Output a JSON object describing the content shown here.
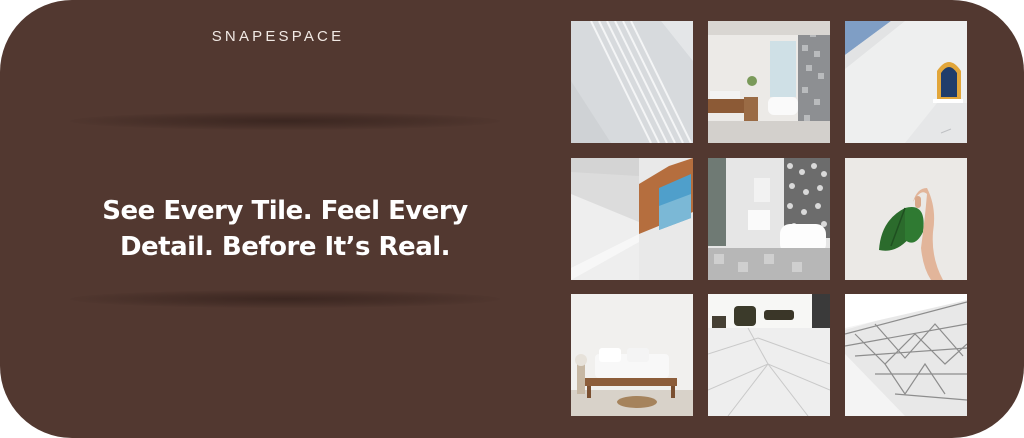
{
  "brand": {
    "name": "SNAPESPACE"
  },
  "hero": {
    "headline_line1": "See Every Tile. Feel Every",
    "headline_line2": "Detail. Before It’s Real."
  },
  "colors": {
    "background": "#523830",
    "text": "#ffffff",
    "brand_text": "#f1e9e4"
  },
  "gallery": {
    "tiles": [
      {
        "subject": "white wall with light and shadow stripes"
      },
      {
        "subject": "bathroom with grey mosaic tile wall"
      },
      {
        "subject": "white wall with small arched window"
      },
      {
        "subject": "corner of room with wooden window frame"
      },
      {
        "subject": "bathroom with patterned tiles and freestanding tub"
      },
      {
        "subject": "hand holding monstera leaf"
      },
      {
        "subject": "living room with white sofa and wooden bench"
      },
      {
        "subject": "marble floor living space"
      },
      {
        "subject": "geometric white ceiling panels"
      }
    ]
  }
}
